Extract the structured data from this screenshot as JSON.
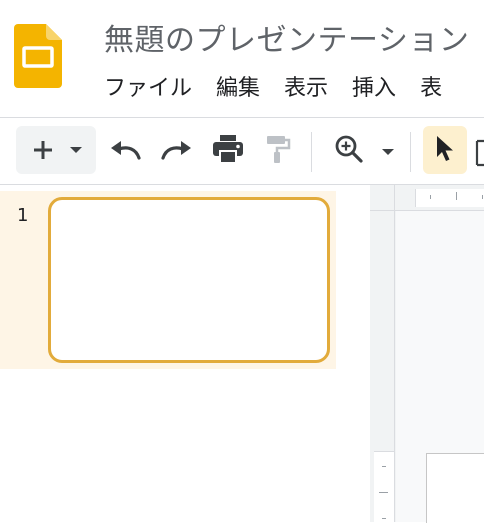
{
  "app": {
    "document_title": "無題のプレゼンテーション",
    "logo_icon": "slides-logo-icon",
    "brand_color": "#f4b400"
  },
  "menu": {
    "items": [
      "ファイル",
      "編集",
      "表示",
      "挿入",
      "表"
    ]
  },
  "toolbar": {
    "icons": [
      "plus-icon",
      "chevron-down-icon",
      "undo-icon",
      "redo-icon",
      "print-icon",
      "paint-format-icon",
      "zoom-icon",
      "chevron-down-icon",
      "cursor-icon"
    ]
  },
  "filmstrip": {
    "slides": [
      {
        "number": "1"
      }
    ],
    "selected_color": "#e2ab3b"
  }
}
